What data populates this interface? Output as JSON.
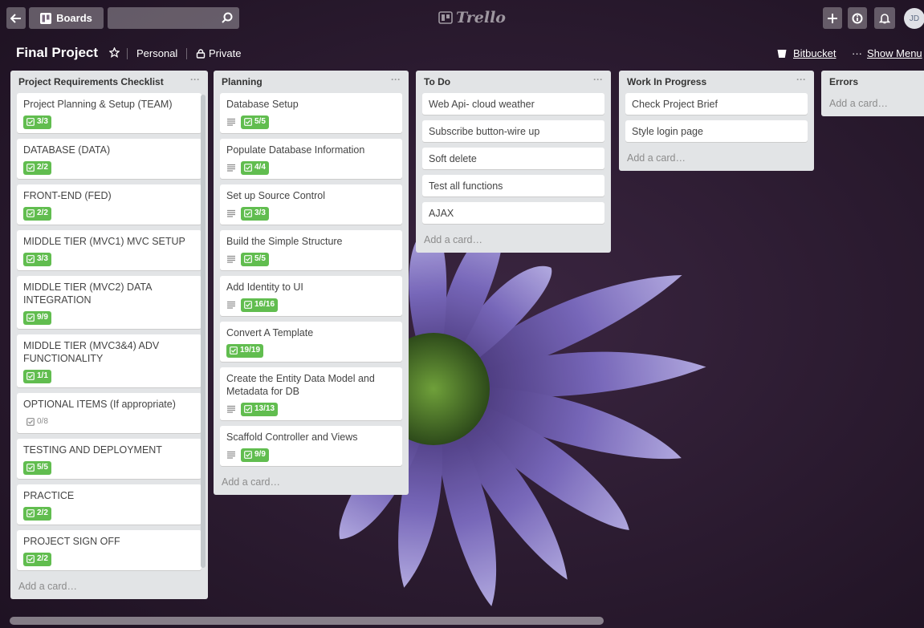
{
  "topbar": {
    "boards_label": "Boards",
    "logo_text": "Trello",
    "avatar_initials": "JD"
  },
  "board": {
    "title": "Final Project",
    "team": "Personal",
    "visibility": "Private",
    "bitbucket": "Bitbucket",
    "show_menu": "Show Menu"
  },
  "colors": {
    "badge_green": "#61bd4f",
    "list_bg": "#e2e4e6"
  },
  "lists": [
    {
      "title": "Project Requirements Checklist",
      "menu": "···",
      "add_card": "Add a card…",
      "cards": [
        {
          "title": "Project Planning & Setup (TEAM)",
          "desc": false,
          "check": "3/3",
          "complete": true
        },
        {
          "title": "DATABASE (DATA)",
          "desc": false,
          "check": "2/2",
          "complete": true
        },
        {
          "title": "FRONT-END (FED)",
          "desc": false,
          "check": "2/2",
          "complete": true
        },
        {
          "title": "MIDDLE TIER (MVC1) MVC SETUP",
          "desc": false,
          "check": "3/3",
          "complete": true
        },
        {
          "title": "MIDDLE TIER (MVC2) DATA INTEGRATION",
          "desc": false,
          "check": "9/9",
          "complete": true
        },
        {
          "title": "MIDDLE TIER (MVC3&4) ADV FUNCTIONALITY",
          "desc": false,
          "check": "1/1",
          "complete": true
        },
        {
          "title": "OPTIONAL ITEMS (If appropriate)",
          "desc": false,
          "check": "0/8",
          "complete": false
        },
        {
          "title": "TESTING AND DEPLOYMENT",
          "desc": false,
          "check": "5/5",
          "complete": true
        },
        {
          "title": "PRACTICE",
          "desc": false,
          "check": "2/2",
          "complete": true
        },
        {
          "title": "PROJECT SIGN OFF",
          "desc": false,
          "check": "2/2",
          "complete": true
        }
      ]
    },
    {
      "title": "Planning",
      "menu": "···",
      "add_card": "Add a card…",
      "cards": [
        {
          "title": "Database Setup",
          "desc": true,
          "check": "5/5",
          "complete": true
        },
        {
          "title": "Populate Database Information",
          "desc": true,
          "check": "4/4",
          "complete": true
        },
        {
          "title": "Set up Source Control",
          "desc": true,
          "check": "3/3",
          "complete": true
        },
        {
          "title": "Build the Simple Structure",
          "desc": true,
          "check": "5/5",
          "complete": true
        },
        {
          "title": "Add Identity to UI",
          "desc": true,
          "check": "16/16",
          "complete": true
        },
        {
          "title": "Convert A Template",
          "desc": false,
          "check": "19/19",
          "complete": true
        },
        {
          "title": "Create the Entity Data Model and Metadata for DB",
          "desc": true,
          "check": "13/13",
          "complete": true
        },
        {
          "title": "Scaffold Controller and Views",
          "desc": true,
          "check": "9/9",
          "complete": true
        }
      ]
    },
    {
      "title": "To Do",
      "menu": "···",
      "add_card": "Add a card…",
      "cards": [
        {
          "title": "Web Api- cloud weather"
        },
        {
          "title": "Subscribe button-wire up"
        },
        {
          "title": "Soft delete"
        },
        {
          "title": "Test all functions"
        },
        {
          "title": "AJAX"
        }
      ]
    },
    {
      "title": "Work In Progress",
      "menu": "···",
      "add_card": "Add a card…",
      "cards": [
        {
          "title": "Check Project Brief"
        },
        {
          "title": "Style login page"
        }
      ]
    },
    {
      "title": "Errors",
      "menu": "",
      "add_card": "Add a card…",
      "cards": []
    }
  ]
}
